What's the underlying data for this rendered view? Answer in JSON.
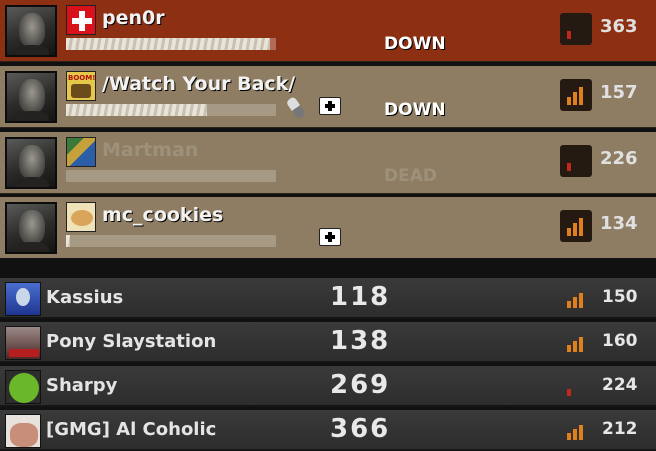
{
  "survivors": [
    {
      "name": "pen0r",
      "status": "DOWN",
      "ping": "363",
      "health": 0.97,
      "avatar_icon": "swiss-flag-icon",
      "dead": false,
      "active": true,
      "medkit": false,
      "pills": false,
      "signal_color": "#c0281a",
      "signal_bars": 1
    },
    {
      "name": "/Watch Your Back/",
      "status": "DOWN",
      "ping": "157",
      "health": 0.67,
      "avatar_icon": "boom-comic-icon",
      "dead": false,
      "active": false,
      "medkit": true,
      "pills": true,
      "signal_color": "#e0801c",
      "signal_bars": 3
    },
    {
      "name": "Martman",
      "status": "DEAD",
      "ping": "226",
      "health": 0.0,
      "avatar_icon": "pixel-character-icon",
      "dead": true,
      "active": false,
      "medkit": false,
      "pills": false,
      "signal_color": "#c0281a",
      "signal_bars": 1
    },
    {
      "name": "mc_cookies",
      "status": "",
      "ping": "134",
      "health": 0.02,
      "avatar_icon": "cookie-icon",
      "dead": false,
      "active": false,
      "medkit": true,
      "pills": false,
      "signal_color": "#e0801c",
      "signal_bars": 3
    }
  ],
  "infected": [
    {
      "name": "Kassius",
      "score": "118",
      "ping": "150",
      "avatar_icon": "cartoon-character-icon",
      "signal_color": "#e0801c",
      "signal_bars": 3
    },
    {
      "name": "Pony Slaystation",
      "score": "138",
      "ping": "160",
      "avatar_icon": "poster-icon",
      "signal_color": "#e0801c",
      "signal_bars": 3
    },
    {
      "name": "Sharpy",
      "score": "269",
      "ping": "224",
      "avatar_icon": "space-invader-icon",
      "signal_color": "#c0281a",
      "signal_bars": 1
    },
    {
      "name": "[GMG] Al Coholic",
      "score": "366",
      "ping": "212",
      "avatar_icon": "meme-face-icon",
      "signal_color": "#e0801c",
      "signal_bars": 3
    }
  ]
}
